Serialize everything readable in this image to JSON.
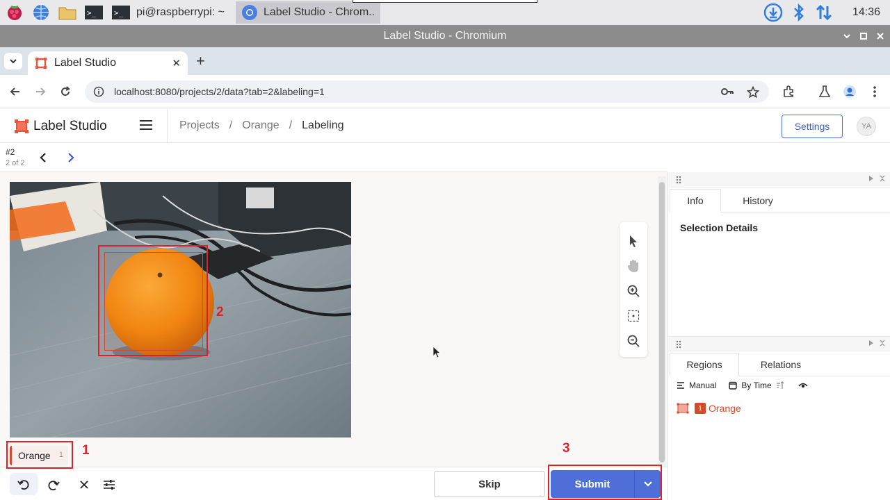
{
  "taskbar": {
    "task_terminal": "pi@raspberrypi: ~",
    "task_browser": "Label Studio - Chrom..",
    "clock": "14:36"
  },
  "window": {
    "title": "Label Studio - Chromium"
  },
  "browser": {
    "tab_title": "Label Studio",
    "tab_close": "✕",
    "new_tab": "+",
    "url": "localhost:8080/projects/2/data?tab=2&labeling=1"
  },
  "app": {
    "logo_text": "Label Studio",
    "breadcrumb": {
      "projects": "Projects",
      "sep": "/",
      "project": "Orange",
      "current": "Labeling"
    },
    "settings_label": "Settings",
    "avatar_initials": "YA"
  },
  "task": {
    "id": "#2",
    "position": "2 of 2"
  },
  "labels": [
    {
      "name": "Orange",
      "hotkey": "1",
      "color": "#d24c2c"
    }
  ],
  "actions": {
    "skip_label": "Skip",
    "submit_label": "Submit"
  },
  "annotations": {
    "one": "1",
    "two": "2",
    "three": "3"
  },
  "panels": {
    "info_tab": "Info",
    "history_tab": "History",
    "selection_details": "Selection Details",
    "regions_tab": "Regions",
    "relations_tab": "Relations",
    "sort_manual": "Manual",
    "sort_by_time": "By Time"
  },
  "regions": [
    {
      "index": "1",
      "label": "Orange"
    }
  ],
  "colors": {
    "accent": "#4f6fd8",
    "label": "#d24c2c",
    "annotation": "#d9232a"
  }
}
